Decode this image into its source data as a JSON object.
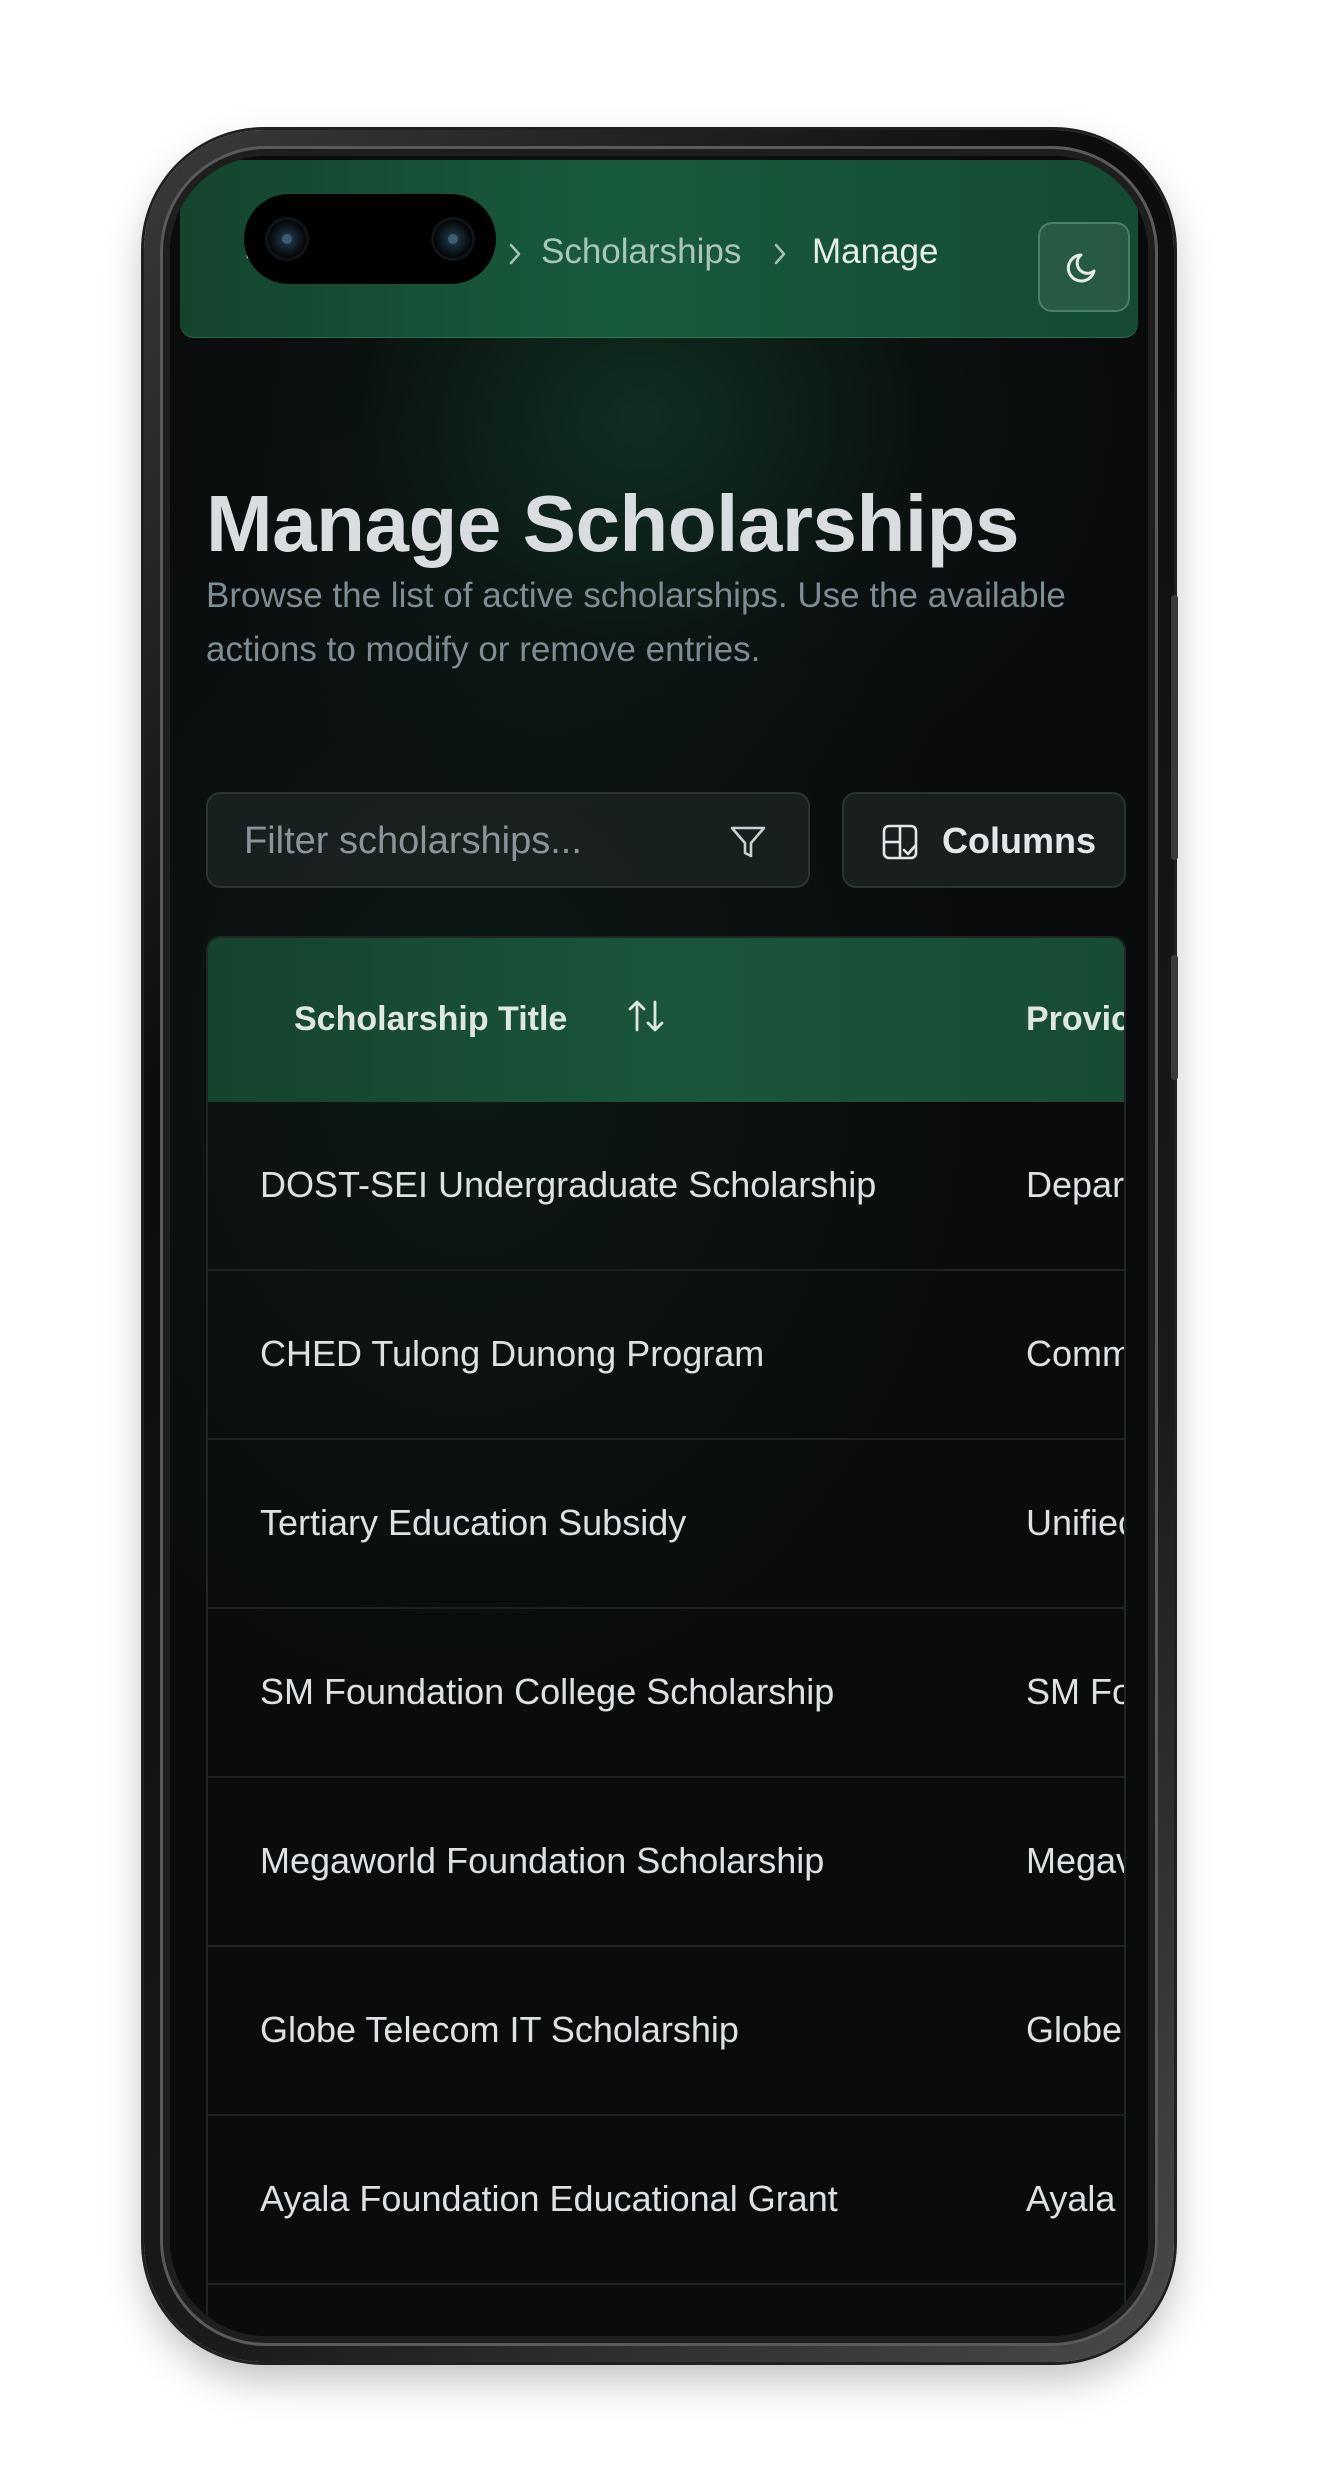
{
  "breadcrumb": {
    "home_icon": "home-icon",
    "items": [
      "Scholarships",
      "Manage"
    ],
    "separator_icon": "chevron-right-icon"
  },
  "header": {
    "theme_toggle_icon": "moon-icon"
  },
  "page": {
    "title": "Manage Scholarships",
    "description": "Browse the list of active scholarships. Use the available actions to modify or remove entries."
  },
  "toolbar": {
    "filter_placeholder": "Filter scholarships...",
    "filter_icon": "filter-icon",
    "columns_label": "Columns",
    "columns_icon": "columns-icon"
  },
  "table": {
    "headers": {
      "title": "Scholarship Title",
      "provider": "Provic"
    },
    "sort_icon": "sort-icon",
    "rows": [
      {
        "title": "DOST-SEI Undergraduate Scholarship",
        "provider": "Depar"
      },
      {
        "title": "CHED Tulong Dunong Program",
        "provider": "Comm"
      },
      {
        "title": "Tertiary Education Subsidy",
        "provider": "Unifiec"
      },
      {
        "title": "SM Foundation College Scholarship",
        "provider": "SM Fo"
      },
      {
        "title": "Megaworld Foundation Scholarship",
        "provider": "Megav"
      },
      {
        "title": "Globe Telecom IT Scholarship",
        "provider": "Globe"
      },
      {
        "title": "Ayala Foundation Educational Grant",
        "provider": "Ayala I"
      }
    ]
  },
  "colors": {
    "accent": "#185a3c",
    "background": "#0a0b0c",
    "text": "#dde1e3",
    "muted_text": "#7e8c93"
  }
}
